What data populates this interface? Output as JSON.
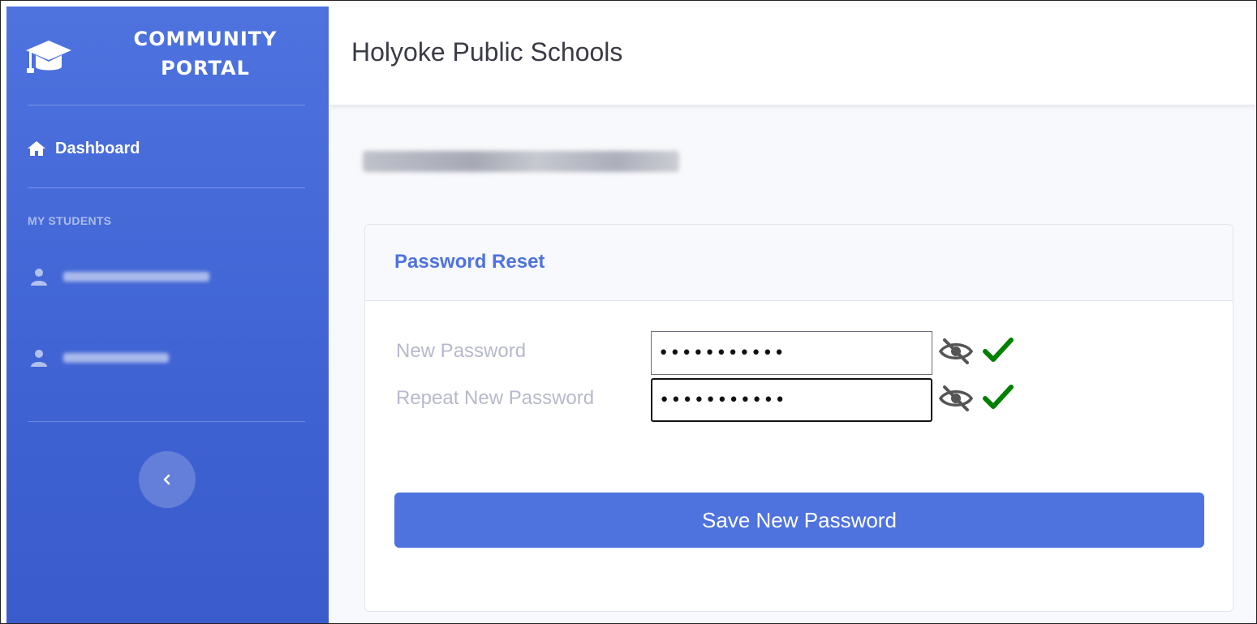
{
  "sidebar": {
    "brand": {
      "line1": "COMMUNITY",
      "line2": "PORTAL",
      "icon": "graduation-cap-icon"
    },
    "nav": {
      "dashboard": {
        "label": "Dashboard",
        "icon": "home-icon"
      }
    },
    "section_heading": "MY STUDENTS",
    "students": [
      {
        "icon": "user-icon",
        "name": ""
      },
      {
        "icon": "user-icon",
        "name": ""
      }
    ],
    "collapse_icon": "chevron-left-icon"
  },
  "header": {
    "title": "Holyoke Public Schools"
  },
  "user": {
    "name": ""
  },
  "card": {
    "title": "Password Reset",
    "fields": [
      {
        "label": "New Password",
        "value": "•••••••••••",
        "toggle_icon": "eye-slash-icon",
        "status_icon": "check-icon",
        "status_color": "#008000"
      },
      {
        "label": "Repeat New Password",
        "value": "•••••••••••",
        "toggle_icon": "eye-slash-icon",
        "status_icon": "check-icon",
        "status_color": "#008000"
      }
    ],
    "save_label": "Save New Password"
  },
  "colors": {
    "primary": "#4e73df",
    "success": "#008000",
    "label": "#b7b9cc"
  }
}
